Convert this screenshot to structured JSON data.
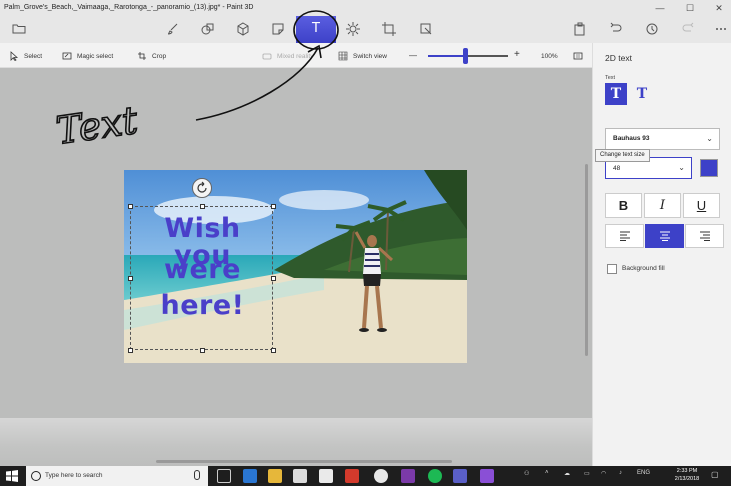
{
  "titlebar": {
    "title": "Palm_Grove's_Beach,_Vaimaaga,_Rarotonga_-_panoramio_(13).jpg* - Paint 3D",
    "minimize_icon": "minimize-icon",
    "maximize_icon": "maximize-icon",
    "close_icon": "close-icon"
  },
  "menubar": {
    "items": [
      {
        "name": "menu",
        "icon": "folder-icon"
      },
      {
        "name": "brushes",
        "icon": "brush-icon"
      },
      {
        "name": "2d-shapes",
        "icon": "2d-shapes-icon"
      },
      {
        "name": "3d-shapes",
        "icon": "cube-icon"
      },
      {
        "name": "stickers",
        "icon": "sticker-icon"
      },
      {
        "name": "text",
        "icon": "text-icon",
        "label": "T",
        "active": true
      },
      {
        "name": "effects",
        "icon": "sun-icon"
      },
      {
        "name": "canvas",
        "icon": "crop-canvas-icon"
      },
      {
        "name": "remix3d",
        "icon": "remix-icon"
      },
      {
        "name": "paste",
        "icon": "paste-icon"
      },
      {
        "name": "undo",
        "icon": "undo-icon"
      },
      {
        "name": "history",
        "icon": "history-icon"
      },
      {
        "name": "redo",
        "icon": "redo-icon"
      },
      {
        "name": "more",
        "icon": "more-icon"
      }
    ],
    "accent": "#3d41c8"
  },
  "toolbar": {
    "select_label": "Select",
    "magic_select_label": "Magic select",
    "crop_label": "Crop",
    "mixed_reality_label": "Mixed reality",
    "switch_view_label": "Switch view",
    "zoom_minus": "—",
    "zoom_plus": "+",
    "zoom_value": "100%",
    "zoom_fraction": 0.46
  },
  "annotation": {
    "handwritten_text": "Text"
  },
  "canvas": {
    "text_lines": [
      "Wish you",
      "were",
      "here!"
    ],
    "text_color": "#4a3fc9"
  },
  "panel": {
    "title": "2D text",
    "text_label": "Text",
    "btn_2d_label": "T",
    "btn_3d_label": "T",
    "font_value": "Bauhaus 93",
    "tooltip": "Change text size",
    "size_value": "48",
    "color": "#3d41c8",
    "bold_label": "B",
    "italic_label": "I",
    "underline_label": "U",
    "align_selected": "center",
    "background_fill_label": "Background fill",
    "background_fill_checked": false
  },
  "taskbar": {
    "search_placeholder": "Type here to search",
    "lang": "ENG",
    "time": "2:33 PM",
    "date": "2/13/2018"
  }
}
